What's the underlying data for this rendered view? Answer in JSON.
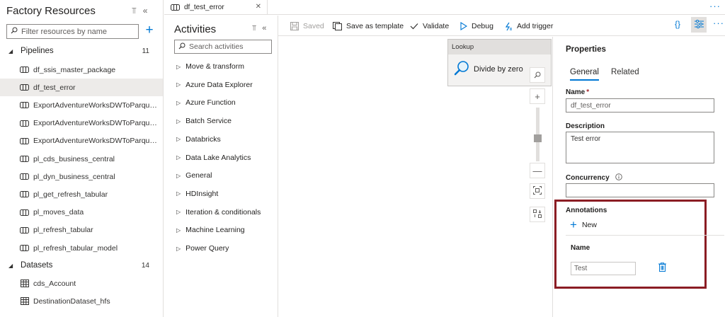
{
  "resources": {
    "title": "Factory Resources",
    "search_placeholder": "Filter resources by name",
    "pipelines": {
      "label": "Pipelines",
      "count": "11",
      "items": [
        {
          "label": "df_ssis_master_package"
        },
        {
          "label": "df_test_error",
          "selected": true
        },
        {
          "label": "ExportAdventureWorksDWToParque..."
        },
        {
          "label": "ExportAdventureWorksDWToParque..."
        },
        {
          "label": "ExportAdventureWorksDWToParque..."
        },
        {
          "label": "pl_cds_business_central"
        },
        {
          "label": "pl_dyn_business_central"
        },
        {
          "label": "pl_get_refresh_tabular"
        },
        {
          "label": "pl_moves_data"
        },
        {
          "label": "pl_refresh_tabular"
        },
        {
          "label": "pl_refresh_tabular_model"
        }
      ]
    },
    "datasets": {
      "label": "Datasets",
      "count": "14",
      "items": [
        {
          "label": "cds_Account"
        },
        {
          "label": "DestinationDataset_hfs"
        }
      ]
    }
  },
  "tab": {
    "label": "df_test_error"
  },
  "activities": {
    "title": "Activities",
    "search_placeholder": "Search activities",
    "categories": [
      "Move & transform",
      "Azure Data Explorer",
      "Azure Function",
      "Batch Service",
      "Databricks",
      "Data Lake Analytics",
      "General",
      "HDInsight",
      "Iteration & conditionals",
      "Machine Learning",
      "Power Query"
    ]
  },
  "toolbar": {
    "saved": "Saved",
    "save_template": "Save as template",
    "validate": "Validate",
    "debug": "Debug",
    "add_trigger": "Add trigger"
  },
  "canvas": {
    "node": {
      "type": "Lookup",
      "name": "Divide by zero"
    }
  },
  "properties": {
    "title": "Properties",
    "tabs": [
      "General",
      "Related"
    ],
    "name_label": "Name",
    "name_required": "*",
    "name_value": "df_test_error",
    "description_label": "Description",
    "description_value": "Test error",
    "concurrency_label": "Concurrency",
    "concurrency_value": "",
    "annotations": {
      "label": "Annotations",
      "new_label": "New",
      "column_header": "Name",
      "rows": [
        {
          "value": "Test"
        }
      ]
    }
  },
  "colors": {
    "accent": "#0078d4",
    "highlight_border": "#8b1d24",
    "selection": "#edebe9"
  }
}
